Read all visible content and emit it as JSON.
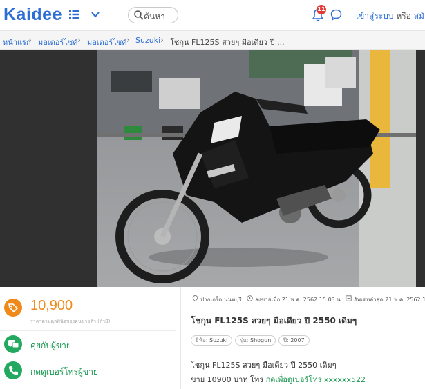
{
  "header": {
    "logo": "Kaidee",
    "search_placeholder": "ค้นหา",
    "notification_count": "11",
    "login_label": "เข้าสู่ระบบ",
    "or_label": "หรือ",
    "register_label": "สมั"
  },
  "breadcrumb": [
    "หน้าแรก",
    "มอเตอร์ไซค์",
    "มอเตอร์ไซค์",
    "Suzuki",
    "โชกุน FL125S สวยๆ มือเดียว ปี ..."
  ],
  "listing": {
    "price": "10,900",
    "price_note": "ราคาตามดุลพินิจของคนขายตัว (ถ้ามี)",
    "chat_label": "คุยกับผู้ขาย",
    "call_label": "กดดูเบอร์โทรผู้ขาย",
    "location": "ปากเกร็ด นนทบุรี",
    "posted": "ลงขายเมื่อ 21 พ.ค. 2562 15:03 น.",
    "updated": "อัพเดทล่าสุด 21 พ.ค. 2562 15:0",
    "title": "โชกุน FL125S สวยๆ มือเดียว ปี 2550 เดิมๆ",
    "chips": [
      {
        "label": "ยี่ห้อ:",
        "value": "Suzuki"
      },
      {
        "label": "รุ่น:",
        "value": "Shogun"
      },
      {
        "label": "ปี:",
        "value": "2007"
      }
    ],
    "desc_line1": "โชกุน FL125S สวยๆ มือเดียว ปี 2550 เดิมๆ",
    "desc_line2_text": "ขาย 10900 บาท โทร",
    "desc_line2_link": "กดเพื่อดูเบอร์โทร xxxxxx522"
  },
  "colors": {
    "brand_blue": "#2d6ed6",
    "price_orange": "#ef8a1a",
    "action_green": "#22a95f"
  },
  "icons": [
    "menu-icon",
    "chevron-down-icon",
    "search-icon",
    "bell-icon",
    "chat-icon",
    "tag-icon",
    "chat-bubbles-icon",
    "phone-icon",
    "location-icon",
    "clock-icon",
    "refresh-icon"
  ]
}
